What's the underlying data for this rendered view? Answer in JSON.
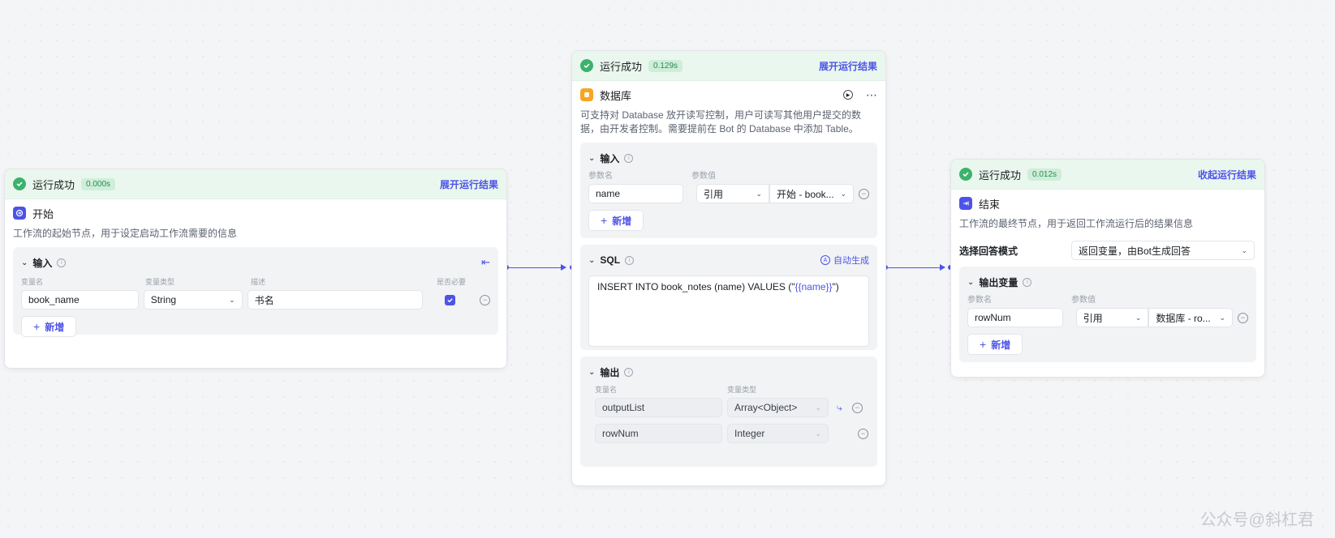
{
  "start_node": {
    "run_status": "运行成功",
    "run_time": "0.000s",
    "toggle_label": "展开运行结果",
    "title": "开始",
    "description": "工作流的起始节点，用于设定启动工作流需要的信息",
    "input": {
      "title": "输入",
      "col_name": "变量名",
      "col_type": "变量类型",
      "col_desc": "描述",
      "col_required": "是否必要",
      "rows": [
        {
          "name": "book_name",
          "type": "String",
          "desc": "书名",
          "required": true
        }
      ],
      "add_label": "新增"
    }
  },
  "db_node": {
    "run_status": "运行成功",
    "run_time": "0.129s",
    "toggle_label": "展开运行结果",
    "title": "数据库",
    "description": "可支持对 Database 放开读写控制，用户可读写其他用户提交的数据，由开发者控制。需要提前在 Bot 的 Database 中添加 Table。",
    "input": {
      "title": "输入",
      "col_name": "参数名",
      "col_value": "参数值",
      "rows": [
        {
          "name": "name",
          "mode": "引用",
          "ref": "开始 - book..."
        }
      ],
      "add_label": "新增"
    },
    "sql": {
      "title": "SQL",
      "auto_label": "自动生成",
      "statement_prefix": "INSERT INTO book_notes (name) VALUES (\"",
      "statement_var": "{{name}}",
      "statement_suffix": "\")"
    },
    "output": {
      "title": "输出",
      "col_name": "变量名",
      "col_type": "变量类型",
      "rows": [
        {
          "name": "outputList",
          "type": "Array<Object>"
        },
        {
          "name": "rowNum",
          "type": "Integer"
        }
      ]
    }
  },
  "end_node": {
    "run_status": "运行成功",
    "run_time": "0.012s",
    "toggle_label": "收起运行结果",
    "title": "结束",
    "description": "工作流的最终节点，用于返回工作流运行后的结果信息",
    "answer_mode_label": "选择回答模式",
    "answer_mode_value": "返回变量，由Bot生成回答",
    "output": {
      "title": "输出变量",
      "col_name": "参数名",
      "col_value": "参数值",
      "rows": [
        {
          "name": "rowNum",
          "mode": "引用",
          "ref": "数据库 - ro..."
        }
      ],
      "add_label": "新增"
    }
  },
  "watermark": "公众号@斜杠君",
  "colors": {
    "accent": "#4d53e8",
    "success": "#3cb26c",
    "db_icon": "#f5a623"
  }
}
